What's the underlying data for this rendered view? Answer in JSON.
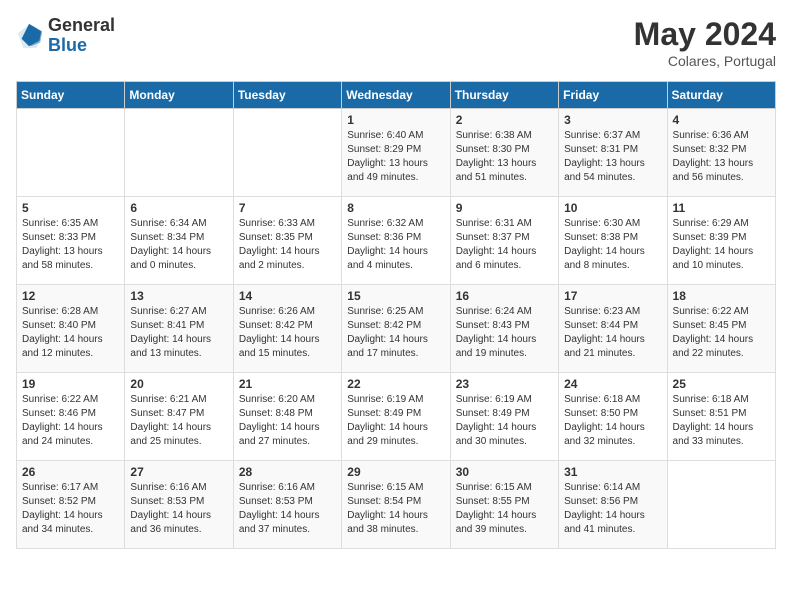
{
  "header": {
    "logo_general": "General",
    "logo_blue": "Blue",
    "month": "May 2024",
    "location": "Colares, Portugal"
  },
  "days_of_week": [
    "Sunday",
    "Monday",
    "Tuesday",
    "Wednesday",
    "Thursday",
    "Friday",
    "Saturday"
  ],
  "weeks": [
    [
      {
        "day": "",
        "info": ""
      },
      {
        "day": "",
        "info": ""
      },
      {
        "day": "",
        "info": ""
      },
      {
        "day": "1",
        "info": "Sunrise: 6:40 AM\nSunset: 8:29 PM\nDaylight: 13 hours\nand 49 minutes."
      },
      {
        "day": "2",
        "info": "Sunrise: 6:38 AM\nSunset: 8:30 PM\nDaylight: 13 hours\nand 51 minutes."
      },
      {
        "day": "3",
        "info": "Sunrise: 6:37 AM\nSunset: 8:31 PM\nDaylight: 13 hours\nand 54 minutes."
      },
      {
        "day": "4",
        "info": "Sunrise: 6:36 AM\nSunset: 8:32 PM\nDaylight: 13 hours\nand 56 minutes."
      }
    ],
    [
      {
        "day": "5",
        "info": "Sunrise: 6:35 AM\nSunset: 8:33 PM\nDaylight: 13 hours\nand 58 minutes."
      },
      {
        "day": "6",
        "info": "Sunrise: 6:34 AM\nSunset: 8:34 PM\nDaylight: 14 hours\nand 0 minutes."
      },
      {
        "day": "7",
        "info": "Sunrise: 6:33 AM\nSunset: 8:35 PM\nDaylight: 14 hours\nand 2 minutes."
      },
      {
        "day": "8",
        "info": "Sunrise: 6:32 AM\nSunset: 8:36 PM\nDaylight: 14 hours\nand 4 minutes."
      },
      {
        "day": "9",
        "info": "Sunrise: 6:31 AM\nSunset: 8:37 PM\nDaylight: 14 hours\nand 6 minutes."
      },
      {
        "day": "10",
        "info": "Sunrise: 6:30 AM\nSunset: 8:38 PM\nDaylight: 14 hours\nand 8 minutes."
      },
      {
        "day": "11",
        "info": "Sunrise: 6:29 AM\nSunset: 8:39 PM\nDaylight: 14 hours\nand 10 minutes."
      }
    ],
    [
      {
        "day": "12",
        "info": "Sunrise: 6:28 AM\nSunset: 8:40 PM\nDaylight: 14 hours\nand 12 minutes."
      },
      {
        "day": "13",
        "info": "Sunrise: 6:27 AM\nSunset: 8:41 PM\nDaylight: 14 hours\nand 13 minutes."
      },
      {
        "day": "14",
        "info": "Sunrise: 6:26 AM\nSunset: 8:42 PM\nDaylight: 14 hours\nand 15 minutes."
      },
      {
        "day": "15",
        "info": "Sunrise: 6:25 AM\nSunset: 8:42 PM\nDaylight: 14 hours\nand 17 minutes."
      },
      {
        "day": "16",
        "info": "Sunrise: 6:24 AM\nSunset: 8:43 PM\nDaylight: 14 hours\nand 19 minutes."
      },
      {
        "day": "17",
        "info": "Sunrise: 6:23 AM\nSunset: 8:44 PM\nDaylight: 14 hours\nand 21 minutes."
      },
      {
        "day": "18",
        "info": "Sunrise: 6:22 AM\nSunset: 8:45 PM\nDaylight: 14 hours\nand 22 minutes."
      }
    ],
    [
      {
        "day": "19",
        "info": "Sunrise: 6:22 AM\nSunset: 8:46 PM\nDaylight: 14 hours\nand 24 minutes."
      },
      {
        "day": "20",
        "info": "Sunrise: 6:21 AM\nSunset: 8:47 PM\nDaylight: 14 hours\nand 25 minutes."
      },
      {
        "day": "21",
        "info": "Sunrise: 6:20 AM\nSunset: 8:48 PM\nDaylight: 14 hours\nand 27 minutes."
      },
      {
        "day": "22",
        "info": "Sunrise: 6:19 AM\nSunset: 8:49 PM\nDaylight: 14 hours\nand 29 minutes."
      },
      {
        "day": "23",
        "info": "Sunrise: 6:19 AM\nSunset: 8:49 PM\nDaylight: 14 hours\nand 30 minutes."
      },
      {
        "day": "24",
        "info": "Sunrise: 6:18 AM\nSunset: 8:50 PM\nDaylight: 14 hours\nand 32 minutes."
      },
      {
        "day": "25",
        "info": "Sunrise: 6:18 AM\nSunset: 8:51 PM\nDaylight: 14 hours\nand 33 minutes."
      }
    ],
    [
      {
        "day": "26",
        "info": "Sunrise: 6:17 AM\nSunset: 8:52 PM\nDaylight: 14 hours\nand 34 minutes."
      },
      {
        "day": "27",
        "info": "Sunrise: 6:16 AM\nSunset: 8:53 PM\nDaylight: 14 hours\nand 36 minutes."
      },
      {
        "day": "28",
        "info": "Sunrise: 6:16 AM\nSunset: 8:53 PM\nDaylight: 14 hours\nand 37 minutes."
      },
      {
        "day": "29",
        "info": "Sunrise: 6:15 AM\nSunset: 8:54 PM\nDaylight: 14 hours\nand 38 minutes."
      },
      {
        "day": "30",
        "info": "Sunrise: 6:15 AM\nSunset: 8:55 PM\nDaylight: 14 hours\nand 39 minutes."
      },
      {
        "day": "31",
        "info": "Sunrise: 6:14 AM\nSunset: 8:56 PM\nDaylight: 14 hours\nand 41 minutes."
      },
      {
        "day": "",
        "info": ""
      }
    ]
  ]
}
